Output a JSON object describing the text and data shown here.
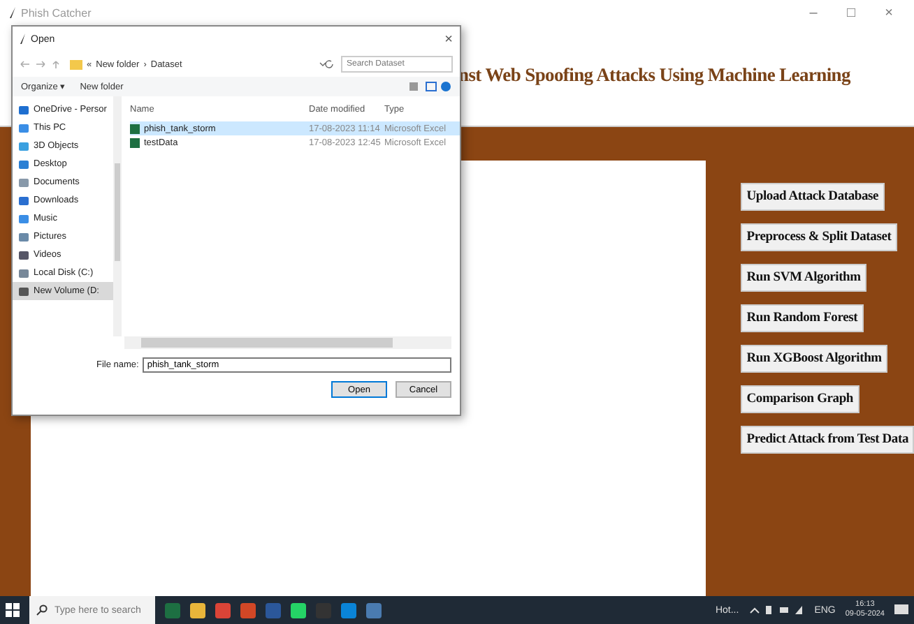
{
  "window": {
    "title": "Phish Catcher",
    "controls": [
      "–",
      "□",
      "×"
    ]
  },
  "header": {
    "title": "nst Web Spoofing Attacks Using Machine Learning"
  },
  "actions": [
    "Upload Attack Database",
    "Preprocess & Split Dataset",
    "Run SVM Algorithm",
    "Run Random Forest",
    "Run XGBoost Algorithm",
    "Comparison Graph",
    "Predict Attack from Test Data"
  ],
  "dialog": {
    "title": "Open",
    "close": "×",
    "path": [
      "«",
      "New folder",
      "›",
      "Dataset"
    ],
    "search": {
      "placeholder": "Search Dataset"
    },
    "toolbar": [
      "Organize ▾",
      "New folder"
    ],
    "nav": [
      {
        "label": "OneDrive - Persor",
        "kind": "cloud",
        "selected": false
      },
      {
        "label": "This PC",
        "kind": "pc",
        "selected": false
      },
      {
        "label": "3D Objects",
        "kind": "cube",
        "selected": false
      },
      {
        "label": "Desktop",
        "kind": "desktop",
        "selected": false
      },
      {
        "label": "Documents",
        "kind": "doc",
        "selected": false
      },
      {
        "label": "Downloads",
        "kind": "down",
        "selected": false
      },
      {
        "label": "Music",
        "kind": "music",
        "selected": false
      },
      {
        "label": "Pictures",
        "kind": "pic",
        "selected": false
      },
      {
        "label": "Videos",
        "kind": "video",
        "selected": false
      },
      {
        "label": "Local Disk (C:)",
        "kind": "disk",
        "selected": false
      },
      {
        "label": "New Volume (D:",
        "kind": "drive",
        "selected": true
      }
    ],
    "columns": [
      "Name",
      "Date modified",
      "Type"
    ],
    "files": [
      {
        "name": "phish_tank_storm",
        "date": "17-08-2023 11:14",
        "type": "Microsoft Excel",
        "selected": true
      },
      {
        "name": "testData",
        "date": "17-08-2023 12:45",
        "type": "Microsoft Excel",
        "selected": false
      }
    ],
    "filename_label": "File name:",
    "filename": "phish_tank_storm",
    "buttons": [
      "Open",
      "Cancel"
    ]
  },
  "taskbar": {
    "search": {
      "placeholder": "Type here to search"
    },
    "weather": "Hot...",
    "language": "ENG",
    "time": "16:13",
    "date": "09-05-2024"
  }
}
